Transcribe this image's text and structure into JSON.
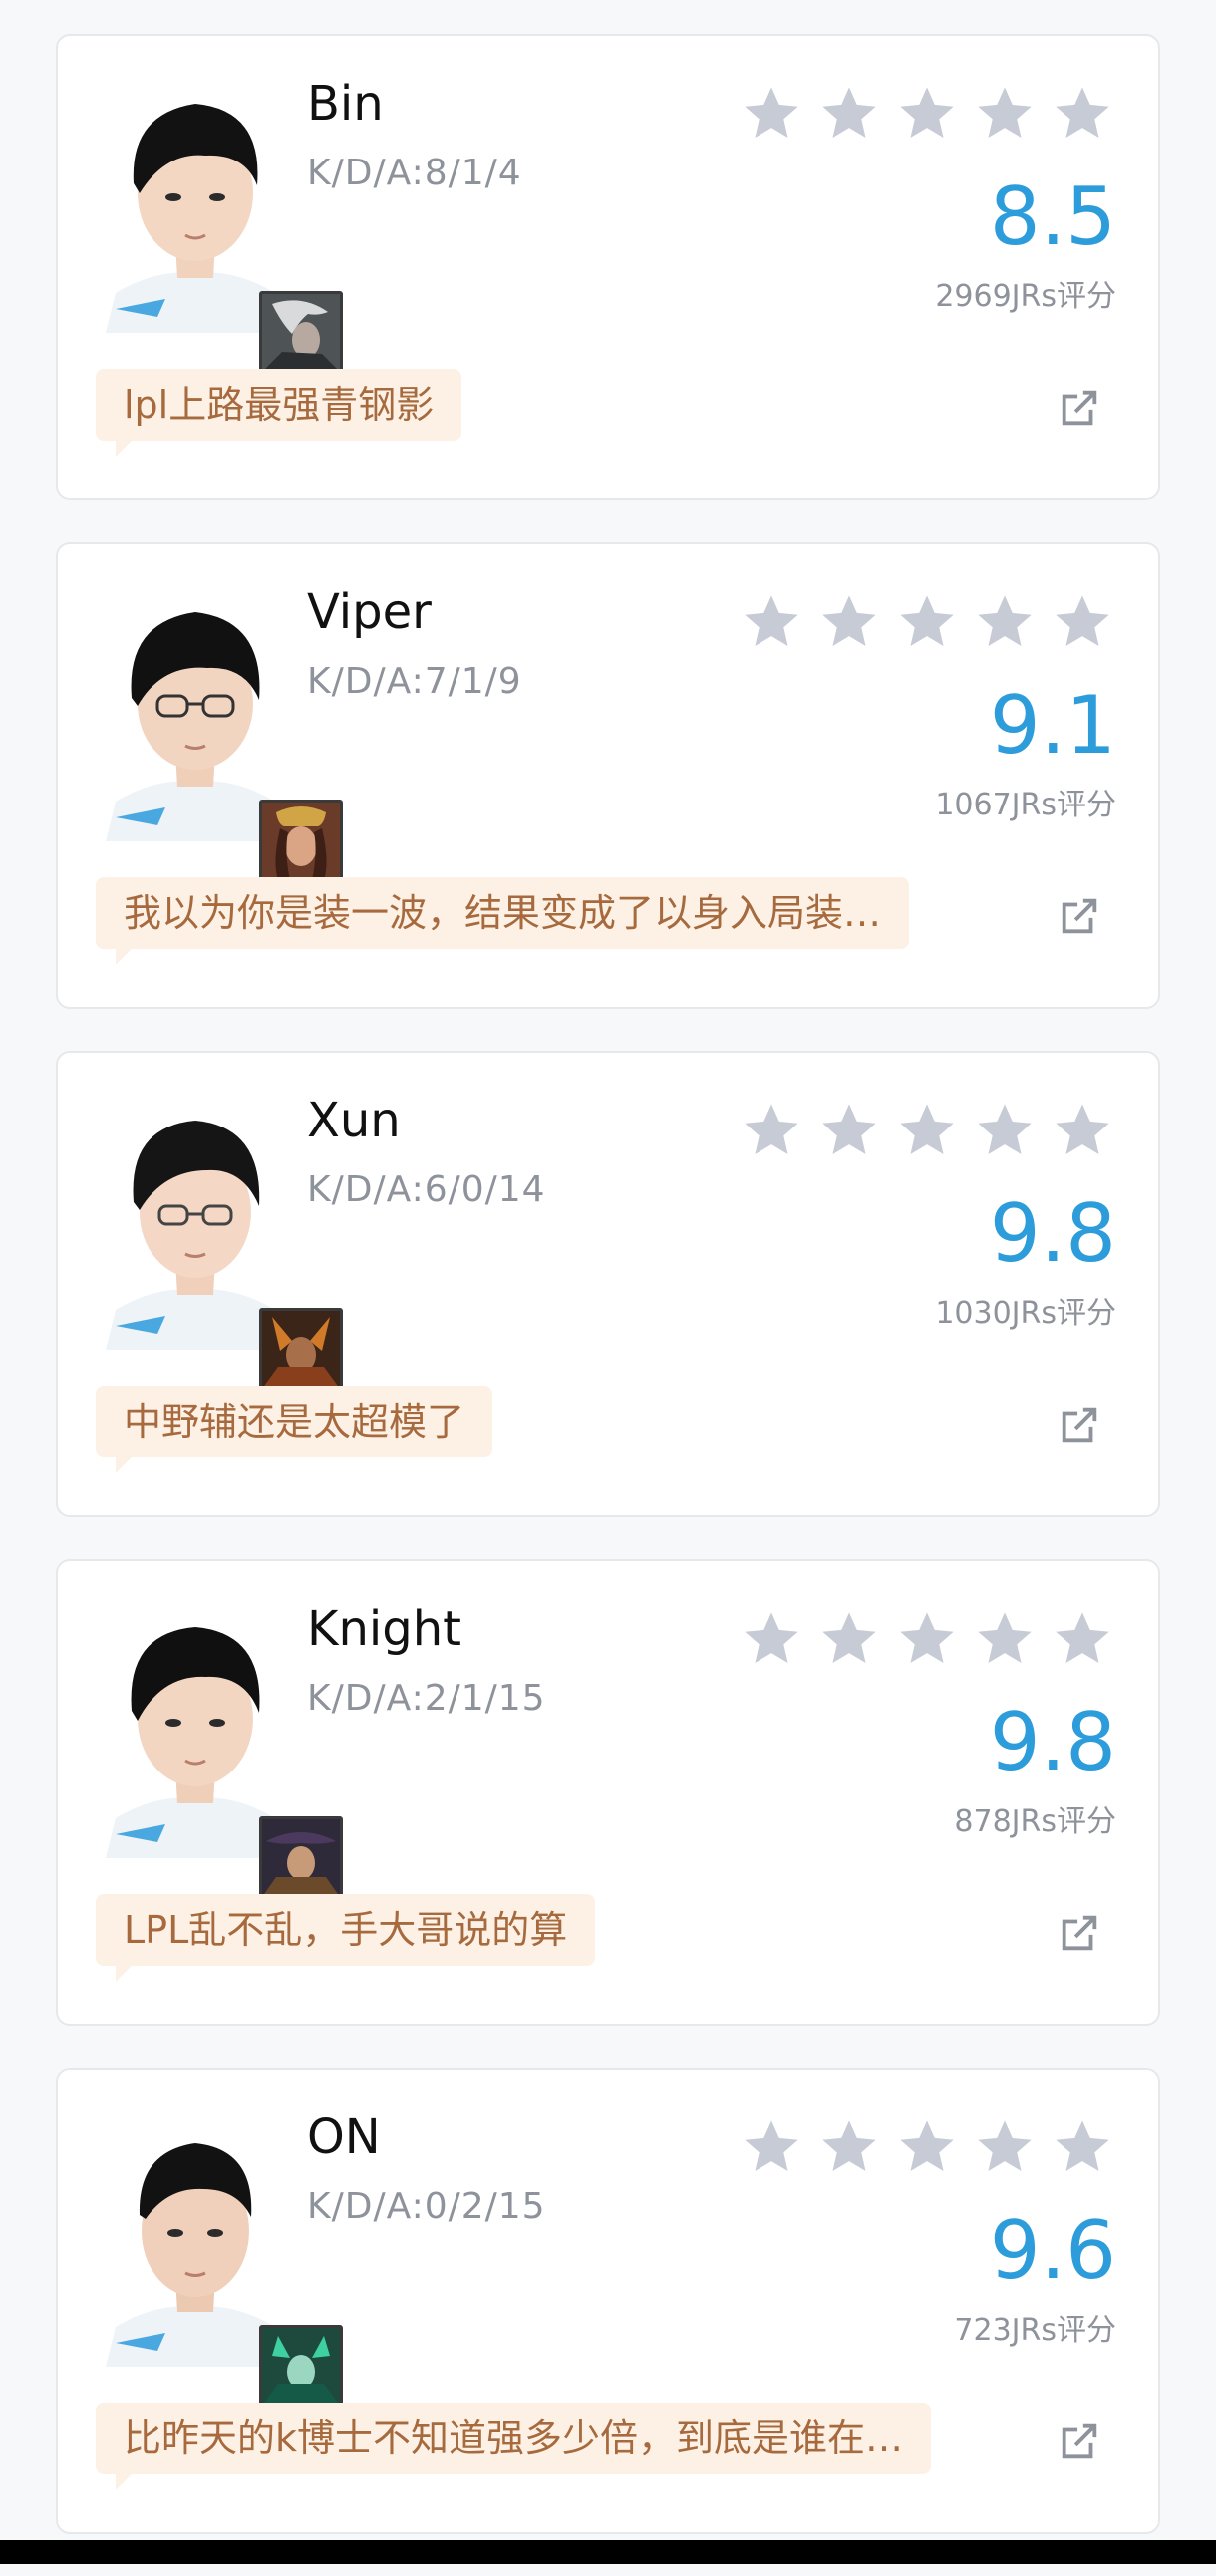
{
  "colors": {
    "score": "#2d9cdb",
    "star": "#c7cbd5",
    "comment_bg": "#fdf1e5",
    "comment_text": "#a66a3e"
  },
  "players": [
    {
      "name": "Bin",
      "kda": "K/D/A:8/1/4",
      "stars_filled": 0,
      "score": "8.5",
      "votes": "2969JRs评分",
      "comment": "lpl上路最强青钢影",
      "champion_icon": "camille-portrait-icon"
    },
    {
      "name": "Viper",
      "kda": "K/D/A:7/1/9",
      "stars_filled": 0,
      "score": "9.1",
      "votes": "1067JRs评分",
      "comment": "我以为你是装一波，结果变成了以身入局装…",
      "champion_icon": "sivir-portrait-icon"
    },
    {
      "name": "Xun",
      "kda": "K/D/A:6/0/14",
      "stars_filled": 0,
      "score": "9.8",
      "votes": "1030JRs评分",
      "comment": "中野辅还是太超模了",
      "champion_icon": "xin-zhao-portrait-icon"
    },
    {
      "name": "Knight",
      "kda": "K/D/A:2/1/15",
      "stars_filled": 0,
      "score": "9.8",
      "votes": "878JRs评分",
      "comment": "LPL乱不乱，手大哥说的算",
      "champion_icon": "twisted-fate-portrait-icon"
    },
    {
      "name": "ON",
      "kda": "K/D/A:0/2/15",
      "stars_filled": 0,
      "score": "9.6",
      "votes": "723JRs评分",
      "comment": "比昨天的k博士不知道强多少倍，到底是谁在…",
      "champion_icon": "karma-portrait-icon"
    }
  ]
}
